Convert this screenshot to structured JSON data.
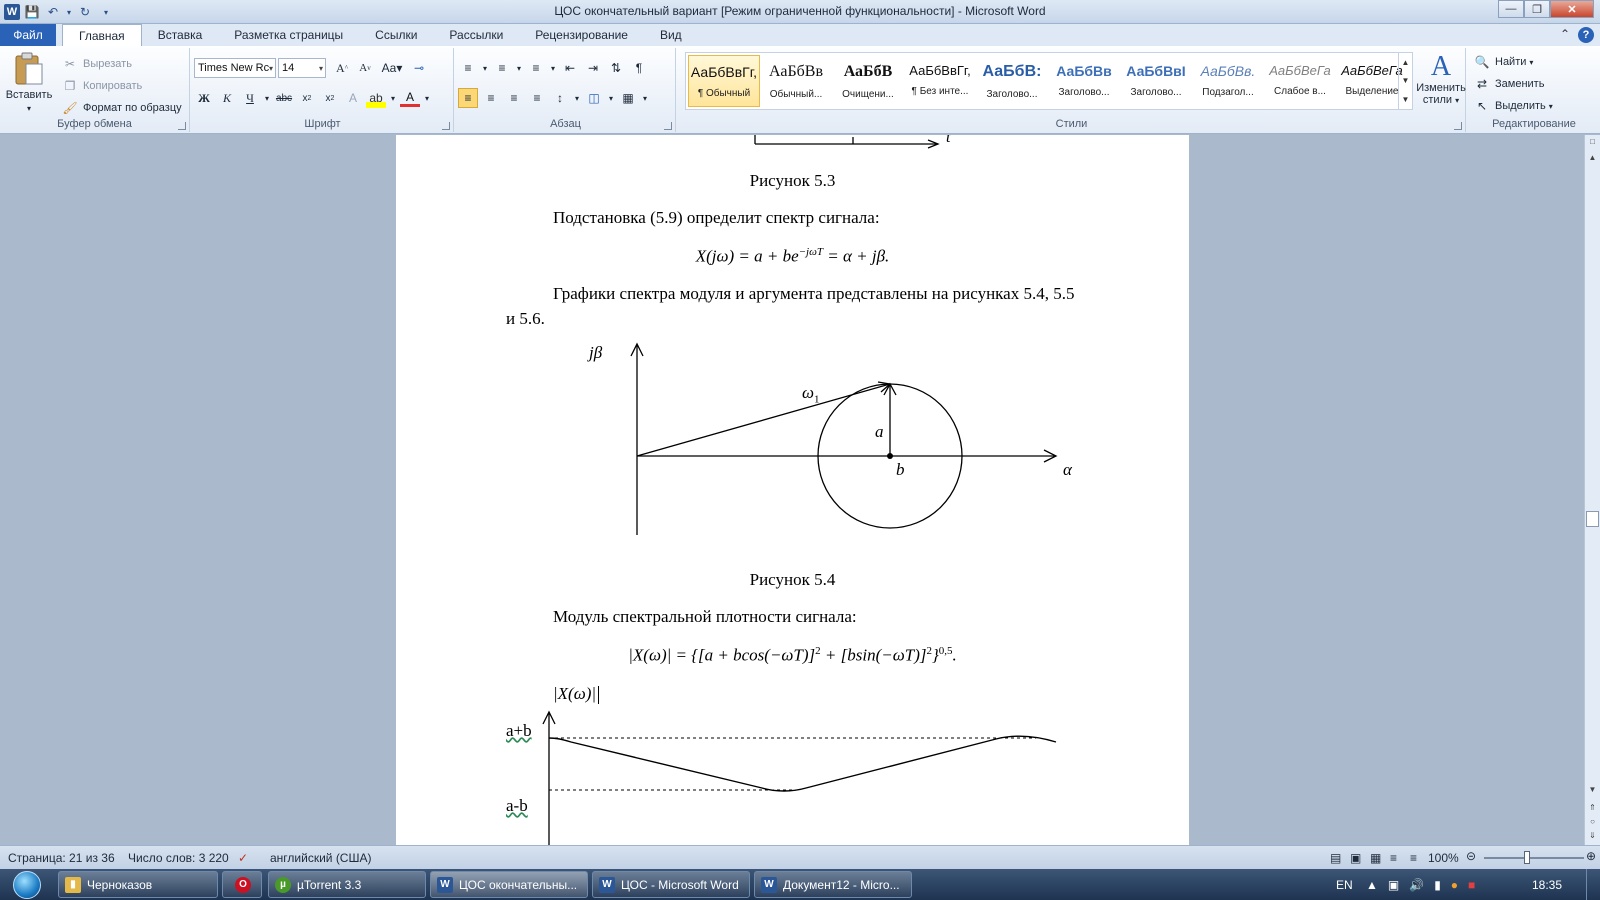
{
  "window": {
    "title": "ЦОС окончательный вариант [Режим ограниченной функциональности]  -  Microsoft Word",
    "app_letter": "W"
  },
  "tabs": [
    {
      "label": "Файл"
    },
    {
      "label": "Главная"
    },
    {
      "label": "Вставка"
    },
    {
      "label": "Разметка страницы"
    },
    {
      "label": "Ссылки"
    },
    {
      "label": "Рассылки"
    },
    {
      "label": "Рецензирование"
    },
    {
      "label": "Вид"
    }
  ],
  "clipboard": {
    "label": "Буфер обмена",
    "paste": "Вставить",
    "cut": "Вырезать",
    "copy": "Копировать",
    "format_painter": "Формат по образцу"
  },
  "font": {
    "label": "Шрифт",
    "name": "Times New Rc",
    "size": "14"
  },
  "paragraph": {
    "label": "Абзац"
  },
  "styles": {
    "label": "Стили",
    "items": [
      {
        "sample": "АаБбВвГг,",
        "name": "¶ Обычный"
      },
      {
        "sample": "АаБбВв",
        "name": "Обычный..."
      },
      {
        "sample": "АаБбВ",
        "name": "Очищени..."
      },
      {
        "sample": "АаБбВвГг,",
        "name": "¶ Без инте..."
      },
      {
        "sample": "АаБбВ:",
        "name": "Заголово..."
      },
      {
        "sample": "АаБбВв",
        "name": "Заголово..."
      },
      {
        "sample": "АаБбВвІ",
        "name": "Заголово..."
      },
      {
        "sample": "АаБбВв.",
        "name": "Подзагол..."
      },
      {
        "sample": "АаБбВеГа",
        "name": "Слабое в..."
      },
      {
        "sample": "АаБбВеГа",
        "name": "Выделение"
      }
    ],
    "change_styles": "Изменить",
    "change_styles2": "стили"
  },
  "editing": {
    "label": "Редактирование",
    "find": "Найти",
    "replace": "Заменить",
    "select": "Выделить"
  },
  "document": {
    "axis_t": "t",
    "caption_53": "Рисунок 5.3",
    "para_subst": "Подстановка (5.9) определит спектр сигнала:",
    "formula_spectrum": "X(jω) = a + be",
    "formula_exp": "−jωT",
    "formula_rest": " = α + jβ.",
    "para_graphs_1": "Графики спектра модуля и аргумента представлены на рисунках 5.4, 5.5",
    "para_graphs_2": "и 5.6.",
    "fig54": {
      "jbeta": "jβ",
      "omega": "ω",
      "omega_sub": "1",
      "a": "a",
      "b": "b",
      "alpha": "α"
    },
    "caption_54": "Рисунок 5.4",
    "para_modulus": "Модуль спектральной плотности сигнала:",
    "formula_modulus": "|X(ω)| = {[a + bcos(−ωT)]",
    "formula_mod_sq1": "2",
    "formula_mod_mid": " + [bsin(−ωT)]",
    "formula_mod_sq2": "2",
    "formula_mod_end": "}",
    "formula_mod_pow": "0,5",
    "formula_mod_dot": ".",
    "fig55": {
      "ylabel": "|X(ω)|",
      "top": "a+b",
      "bottom": "a-b"
    }
  },
  "status": {
    "page": "Страница: 21 из 36",
    "words": "Число слов: 3 220",
    "language": "английский (США)",
    "zoom": "100%"
  },
  "taskbar": {
    "items": [
      {
        "label": "Черноказов"
      },
      {
        "label": "µTorrent 3.3"
      },
      {
        "label": "ЦОС окончательны..."
      },
      {
        "label": "ЦОС - Microsoft Word"
      },
      {
        "label": "Документ12 - Micro..."
      }
    ],
    "lang": "EN",
    "clock": "18:35"
  }
}
